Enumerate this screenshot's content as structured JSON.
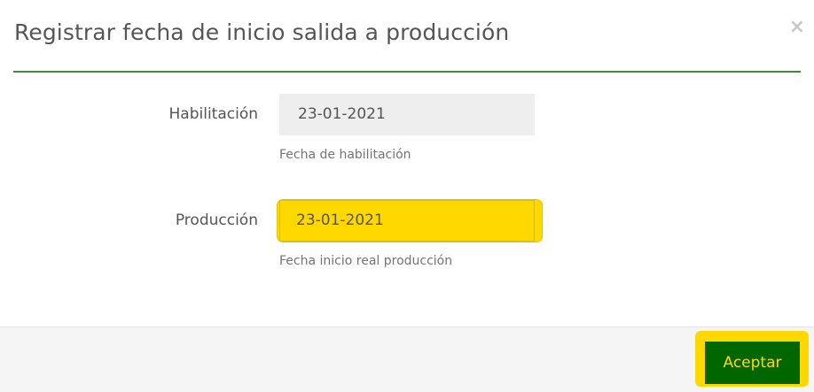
{
  "dialog": {
    "title": "Registrar fecha de inicio salida a producción",
    "close_glyph": "×"
  },
  "form": {
    "habilitacion": {
      "label": "Habilitación",
      "value": "23-01-2021",
      "help": "Fecha de habilitación"
    },
    "produccion": {
      "label": "Producción",
      "value": "23-01-2021",
      "help": "Fecha inicio real producción"
    }
  },
  "footer": {
    "accept_label": "Aceptar"
  },
  "colors": {
    "accent_green": "#3b8c3b",
    "button_green": "#006600",
    "highlight_yellow": "#ffd800"
  }
}
